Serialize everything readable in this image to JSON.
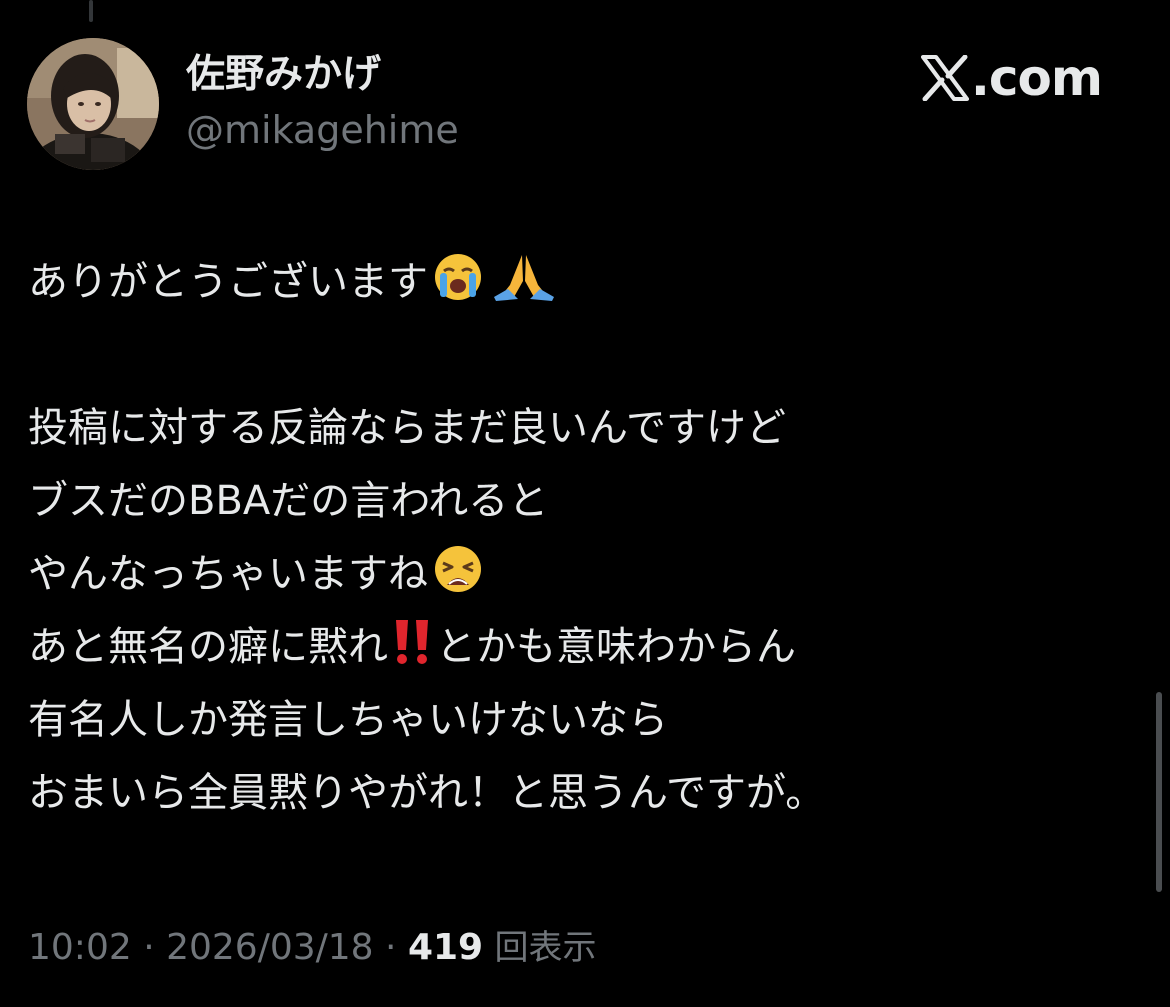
{
  "author": {
    "display_name": "佐野みかげ",
    "handle": "@mikagehime",
    "avatar": "profile-photo"
  },
  "brand": {
    "logo": "x-logo-icon",
    "text": ".com"
  },
  "tweet": {
    "line1": "ありがとうございます",
    "line1_emojis": [
      "loudly-crying-face-emoji",
      "folded-hands-emoji"
    ],
    "line3": "投稿に対する反論ならまだ良いんですけど",
    "line4": "ブスだのBBAだの言われると",
    "line5": "やんなっちゃいますね",
    "line5_emoji": "weary-face-emoji",
    "line6_before": "あと無名の癖に黙れ",
    "line6_emoji": "double-exclamation-emoji",
    "line6_after": "とかも意味わからん",
    "line7": "有名人しか発言しちゃいけないなら",
    "line8": "おまいら全員黙りやがれ！と思うんですが。"
  },
  "meta": {
    "time": "10:02",
    "separator": " · ",
    "date": "2026/03/18",
    "views_count": "419",
    "views_label": "回表示"
  },
  "colors": {
    "background": "#000000",
    "primary_text": "#e7e9ea",
    "secondary_text": "#71767b"
  }
}
